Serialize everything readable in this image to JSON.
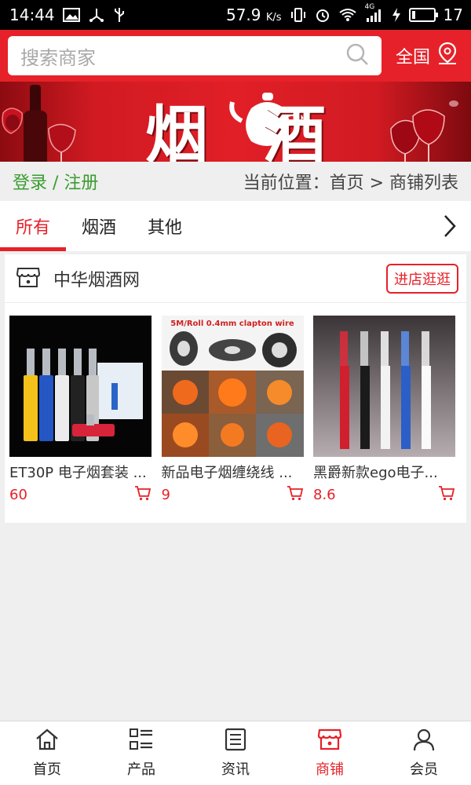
{
  "status_bar": {
    "time": "14:44",
    "net_speed": "57.9",
    "net_unit": "K/s",
    "signal_type": "4G",
    "battery_level": "17",
    "icons": [
      "image-icon",
      "usb-icon",
      "vibrate-icon",
      "alarm-icon",
      "wifi-icon",
      "signal-icon",
      "charging-icon",
      "battery-icon"
    ]
  },
  "header": {
    "search_placeholder": "搜索商家",
    "region_label": "全国",
    "accent_color": "#e62129"
  },
  "banner": {
    "title": "烟酒"
  },
  "breadcrumb": {
    "login_label": "登录",
    "separator": " / ",
    "register_label": "注册",
    "location_label": "当前位置：首页 > 商铺列表"
  },
  "tabs": [
    {
      "label": "所有",
      "active": true
    },
    {
      "label": "烟酒",
      "active": false
    },
    {
      "label": "其他",
      "active": false
    }
  ],
  "shop": {
    "name": "中华烟酒网",
    "visit_label": "进店逛逛",
    "products": [
      {
        "name": "ET30P 电子烟套装 ...",
        "price": "60"
      },
      {
        "name": "新品电子烟缠绕线 ...",
        "price": "9",
        "image_text": "5M/Roll  0.4mm clapton wire"
      },
      {
        "name": "黑爵新款ego电子...",
        "price": "8.6"
      }
    ]
  },
  "bottom_nav": [
    {
      "label": "首页",
      "icon": "home-icon",
      "active": false
    },
    {
      "label": "产品",
      "icon": "grid-list-icon",
      "active": false
    },
    {
      "label": "资讯",
      "icon": "news-icon",
      "active": false
    },
    {
      "label": "商铺",
      "icon": "store-icon",
      "active": true
    },
    {
      "label": "会员",
      "icon": "user-icon",
      "active": false
    }
  ]
}
